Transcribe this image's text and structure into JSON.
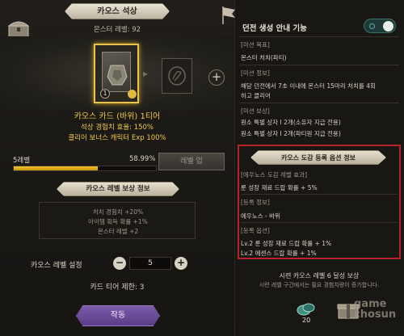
{
  "left_panel": {
    "title": "카오스 석상",
    "monster_level": "몬스터 레벨: 92",
    "card_count": "1",
    "card_name": "카오스 카드 (바위) 1티어",
    "card_stat_1": "석상 경험치 효율: 150%",
    "card_stat_2": "클리어 보너스 캐릭터 Exp 100%",
    "level_label": "5레벨",
    "level_percent": "58.99%",
    "level_progress": 0.5899,
    "level_up_button": "레벨 업",
    "reward_title": "카오스 레벨 보상 정보",
    "rewards": [
      "처치 경험치 +20%",
      "아이템 획득 확률 +1%",
      "몬스터 레벨 +2"
    ],
    "level_setting_label": "카오스 레벨 설정",
    "level_setting_value": "5",
    "card_tier_limit": "카드 티어 제한: 3",
    "make_button": "작동"
  },
  "right_panel": {
    "guide_title": "던전 생성 안내 기능",
    "guide_toggle_on": true,
    "mission_goal_header": "[미션 목표]",
    "mission_goal": "몬스터 처치(파티)",
    "mission_info_header": "[미션 정보]",
    "mission_info_line1": "해당 던전에서 7초 이내에 몬스터 15마리 처치를 4회",
    "mission_info_line2": "하고 클리어",
    "mission_reward_header": "[미션 보상]",
    "mission_reward_1": "원소 특별 상자 Ⅰ 2개(소유자 지급 전용)",
    "mission_reward_2": "원소 특별 상자 Ⅰ 2개(파티원 지급 전용)",
    "option_title": "카오스 도감 등록 옵션 정보",
    "dex_effect_header": "[에우노스 도감 레벨 효과]",
    "dex_effect": "룬 성장 재료 드랍 확률 + 5%",
    "registration_header": "[등록 정보]",
    "registration": "에우노스 - 바위",
    "registered_option_header": "[등록 옵션]",
    "option_1": "Lv.2 룬 성장 재료 드랍 확률 + 1%",
    "option_2": "Lv.2 에센스 드랍 확률 + 1%",
    "reach_title": "시련 카오스 레벨 6 달성 보상",
    "reach_desc": "시련 레벨 구간에서는 필요 경험치량이 증가합니다.",
    "reward_gem_count": "20",
    "watermark_1": "game",
    "watermark_2": "chosun"
  },
  "colors": {
    "accent_gold": "#f0c84a",
    "progress_gold": "#f5c52c",
    "highlight_red": "#b4232c",
    "button_purple": "#6b4c98",
    "toggle_teal": "#3c6e6a"
  }
}
